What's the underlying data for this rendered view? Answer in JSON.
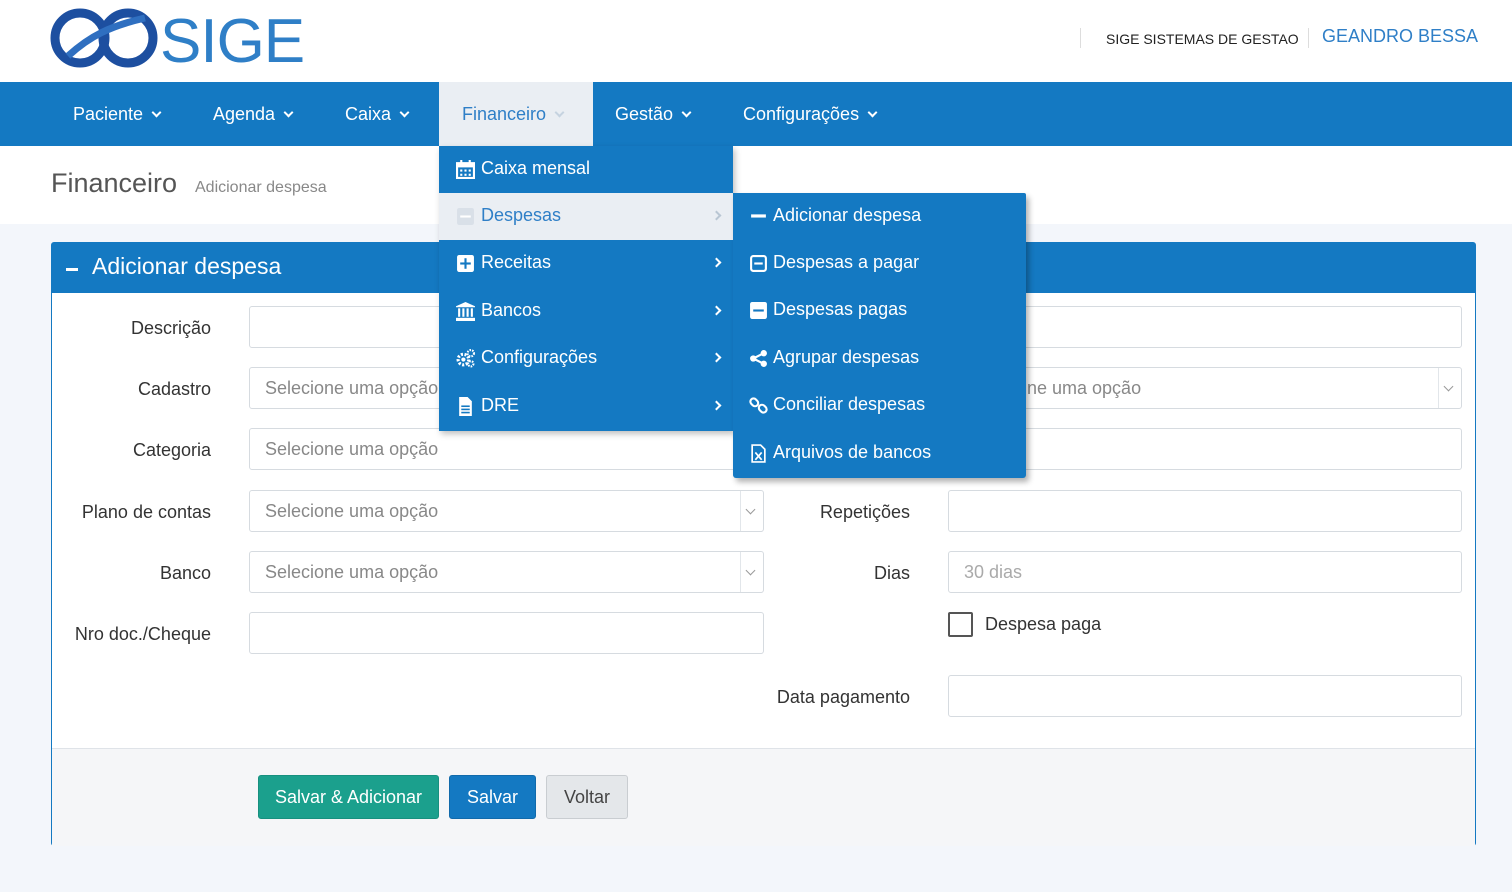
{
  "header": {
    "logo_text": "SIGE",
    "company": "SIGE SISTEMAS DE GESTAO",
    "user": "GEANDRO BESSA"
  },
  "nav": {
    "items": [
      {
        "label": "Paciente"
      },
      {
        "label": "Agenda"
      },
      {
        "label": "Caixa"
      },
      {
        "label": "Financeiro",
        "active": true
      },
      {
        "label": "Gestão"
      },
      {
        "label": "Configurações"
      }
    ]
  },
  "breadcrumb": {
    "title": "Financeiro",
    "subtitle": "Adicionar despesa"
  },
  "panel": {
    "title": "Adicionar despesa"
  },
  "form": {
    "descricao": {
      "label": "Descrição",
      "value": ""
    },
    "cadastro": {
      "label": "Cadastro",
      "placeholder": "Selecione uma opção"
    },
    "categoria": {
      "label": "Categoria",
      "placeholder": "Selecione uma opção"
    },
    "plano_contas": {
      "label": "Plano de contas",
      "placeholder": "Selecione uma opção"
    },
    "banco": {
      "label": "Banco",
      "placeholder": "Selecione uma opção"
    },
    "nro_doc": {
      "label": "Nro doc./Cheque",
      "value": ""
    },
    "right_select": {
      "placeholder_partial": "ne uma opção"
    },
    "repeticoes": {
      "label": "Repetições",
      "value": ""
    },
    "dias": {
      "label": "Dias",
      "placeholder": "30 dias"
    },
    "despesa_paga": {
      "label": "Despesa paga",
      "checked": false
    },
    "data_pagamento": {
      "label": "Data pagamento",
      "value": ""
    }
  },
  "buttons": {
    "salvar_adicionar": "Salvar & Adicionar",
    "salvar": "Salvar",
    "voltar": "Voltar"
  },
  "financeiro_menu": {
    "items": [
      {
        "label": "Caixa mensal",
        "icon": "calendar-icon"
      },
      {
        "label": "Despesas",
        "icon": "minus-square-icon",
        "highlighted": true,
        "submenu": true
      },
      {
        "label": "Receitas",
        "icon": "plus-square-icon",
        "submenu": true
      },
      {
        "label": "Bancos",
        "icon": "bank-icon",
        "submenu": true
      },
      {
        "label": "Configurações",
        "icon": "cogs-icon",
        "submenu": true
      },
      {
        "label": "DRE",
        "icon": "file-icon",
        "submenu": true
      }
    ]
  },
  "despesas_submenu": {
    "items": [
      {
        "label": "Adicionar despesa",
        "icon": "minus-icon"
      },
      {
        "label": "Despesas a pagar",
        "icon": "minus-square-outline-icon"
      },
      {
        "label": "Despesas pagas",
        "icon": "minus-square-icon"
      },
      {
        "label": "Agrupar despesas",
        "icon": "share-icon"
      },
      {
        "label": "Conciliar despesas",
        "icon": "link-icon"
      },
      {
        "label": "Arquivos de bancos",
        "icon": "file-excel-icon"
      }
    ]
  },
  "colors": {
    "primary": "#1479c2",
    "success": "#1ba08d",
    "link": "#2f7fc7",
    "background": "#f3f6fb"
  }
}
